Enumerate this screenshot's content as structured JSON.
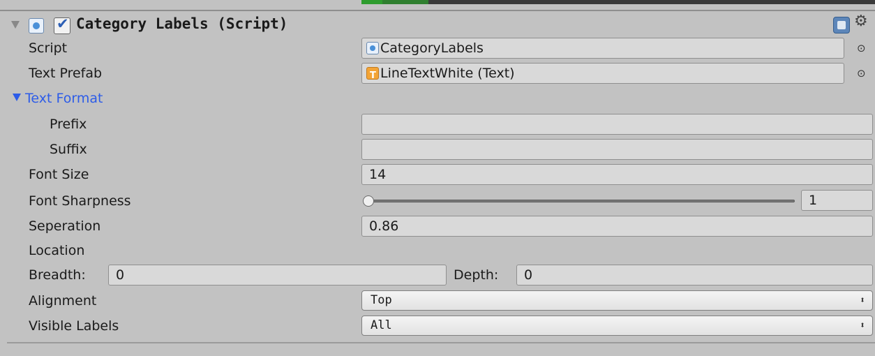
{
  "component": {
    "title": "Category Labels (Script)"
  },
  "fields": {
    "script": {
      "label": "Script",
      "value": "CategoryLabels"
    },
    "text_prefab": {
      "label": "Text Prefab",
      "value": "LineTextWhite (Text)"
    },
    "text_format": {
      "label": "Text Format"
    },
    "prefix": {
      "label": "Prefix",
      "value": ""
    },
    "suffix": {
      "label": "Suffix",
      "value": ""
    },
    "font_size": {
      "label": "Font Size",
      "value": "14"
    },
    "font_sharpness": {
      "label": "Font Sharpness",
      "value": "1",
      "slider_fraction": 0.0
    },
    "seperation": {
      "label": "Seperation",
      "value": "0.86"
    },
    "location": {
      "label": "Location"
    },
    "breadth": {
      "label": "Breadth:",
      "value": "0"
    },
    "depth": {
      "label": "Depth:",
      "value": "0"
    },
    "alignment": {
      "label": "Alignment",
      "value": "Top"
    },
    "visible_labels": {
      "label": "Visible Labels",
      "value": "All"
    }
  },
  "icons": {
    "fold": "fold-triangle-icon",
    "script": "csharp-script-icon",
    "enabled": "checkbox-checked-icon",
    "help": "help-book-icon",
    "settings": "gear-icon",
    "object_picker": "object-picker-icon",
    "text_component": "text-component-icon",
    "dropdown": "up-down-arrows-icon"
  },
  "colors": {
    "background": "#c2c2c2",
    "section_label": "#2d5ce8",
    "field_bg": "#d9d9d9"
  }
}
